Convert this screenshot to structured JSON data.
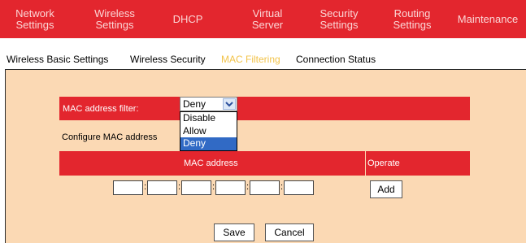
{
  "topnav": {
    "items": [
      {
        "label": "Network\nSettings"
      },
      {
        "label": "Wireless\nSettings"
      },
      {
        "label": "DHCP"
      },
      {
        "label": "Virtual\nServer"
      },
      {
        "label": "Security\nSettings"
      },
      {
        "label": "Routing\nSettings"
      },
      {
        "label": "Maintenance"
      }
    ],
    "active_index": 1
  },
  "subnav": {
    "items": [
      {
        "label": "Wireless Basic Settings"
      },
      {
        "label": "Wireless Security"
      },
      {
        "label": "MAC Filtering"
      },
      {
        "label": "Connection Status"
      }
    ],
    "active_index": 2
  },
  "mac_filter": {
    "label": "MAC address filter:",
    "selected": "Deny",
    "options": [
      "Disable",
      "Allow",
      "Deny"
    ],
    "highlighted_option": "Deny"
  },
  "configure": {
    "label": "Configure MAC address",
    "col_mac": "MAC address",
    "col_operate": "Operate",
    "fields": [
      "",
      "",
      "",
      "",
      "",
      ""
    ],
    "separator": ":",
    "add_label": "Add"
  },
  "actions": {
    "save_label": "Save",
    "cancel_label": "Cancel"
  },
  "colors": {
    "nav_red": "#e3262e",
    "panel_bg": "#fbd9b4",
    "active_subtab": "#f2c34a",
    "selection_blue": "#316ac5"
  }
}
